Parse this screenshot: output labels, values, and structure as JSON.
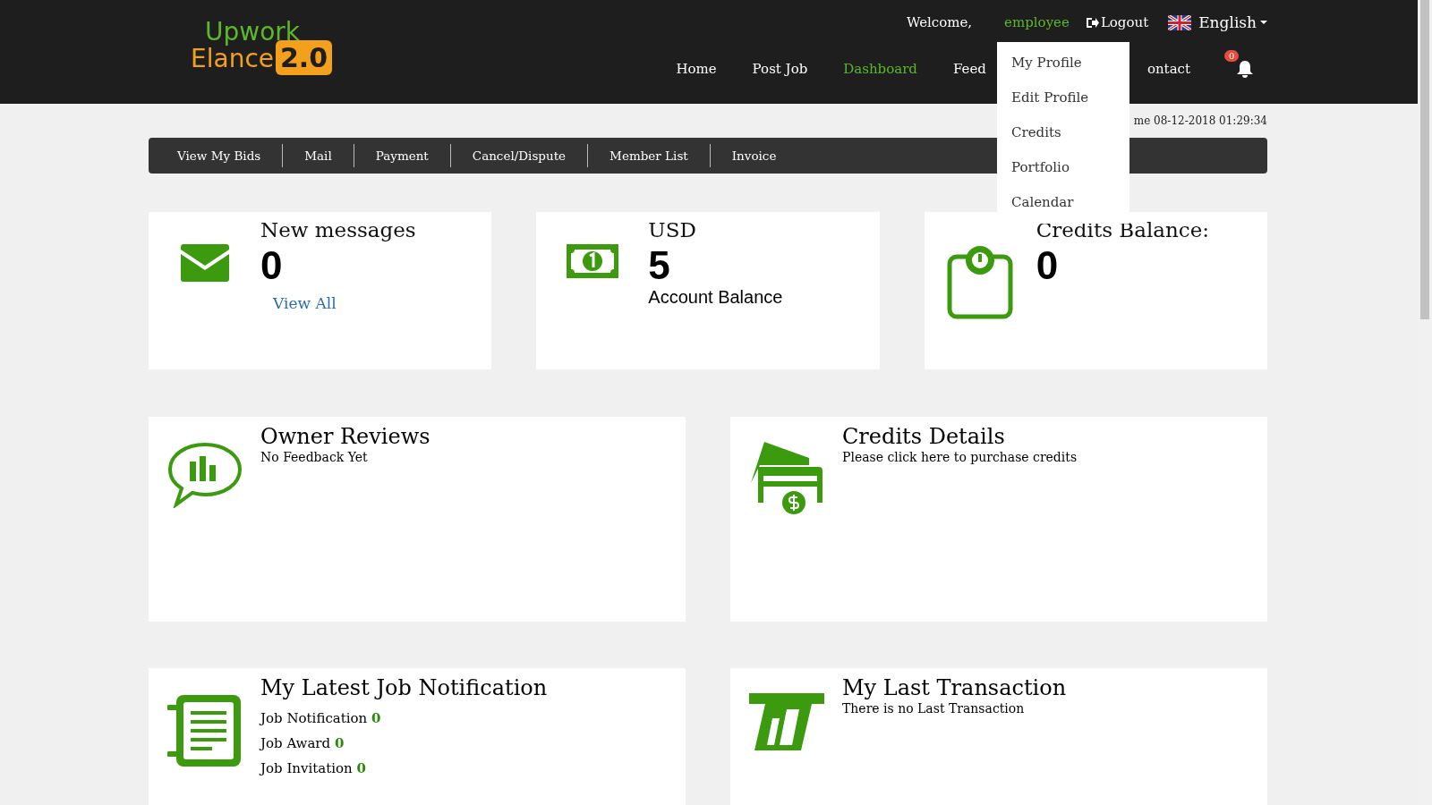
{
  "header": {
    "logo": {
      "line1": "Upwork",
      "line2": "Elance",
      "badge": "2.0"
    },
    "welcome": "Welcome,",
    "username": "employee",
    "logout": "Logout",
    "language": "English",
    "nav": [
      {
        "label": "Home",
        "selected": false
      },
      {
        "label": "Post Job",
        "selected": false
      },
      {
        "label": "Dashboard",
        "selected": true
      },
      {
        "label": "Feed",
        "selected": false
      },
      {
        "label": "ontact",
        "selected": false
      }
    ],
    "notifications_count": "0",
    "user_menu": [
      "My Profile",
      "Edit Profile",
      "Credits",
      "Portfolio",
      "Calendar"
    ]
  },
  "last_login": "me 08-12-2018 01:29:34",
  "subnav": [
    "View My Bids",
    "Mail",
    "Payment",
    "Cancel/Dispute",
    "Member List",
    "Invoice"
  ],
  "summary_cards": [
    {
      "kind": "messages",
      "title": "New messages",
      "value": "0",
      "link": "View All"
    },
    {
      "kind": "money",
      "title": "USD",
      "value": "5",
      "caption": "Account Balance"
    },
    {
      "kind": "credits",
      "title": "Credits Balance:",
      "value": "0"
    }
  ],
  "panels": [
    {
      "kind": "reviews",
      "title": "Owner Reviews",
      "text": "No Feedback Yet"
    },
    {
      "kind": "credits",
      "title": "Credits Details",
      "text": "Please click here to purchase credits"
    },
    {
      "kind": "jobs",
      "title": "My Latest Job Notification",
      "stats": [
        {
          "label": "Job Notification",
          "value": "0"
        },
        {
          "label": "Job Award",
          "value": "0"
        },
        {
          "label": "Job Invitation",
          "value": "0"
        }
      ]
    },
    {
      "kind": "transaction",
      "title": "My Last Transaction",
      "text": "There is no Last Transaction"
    }
  ]
}
